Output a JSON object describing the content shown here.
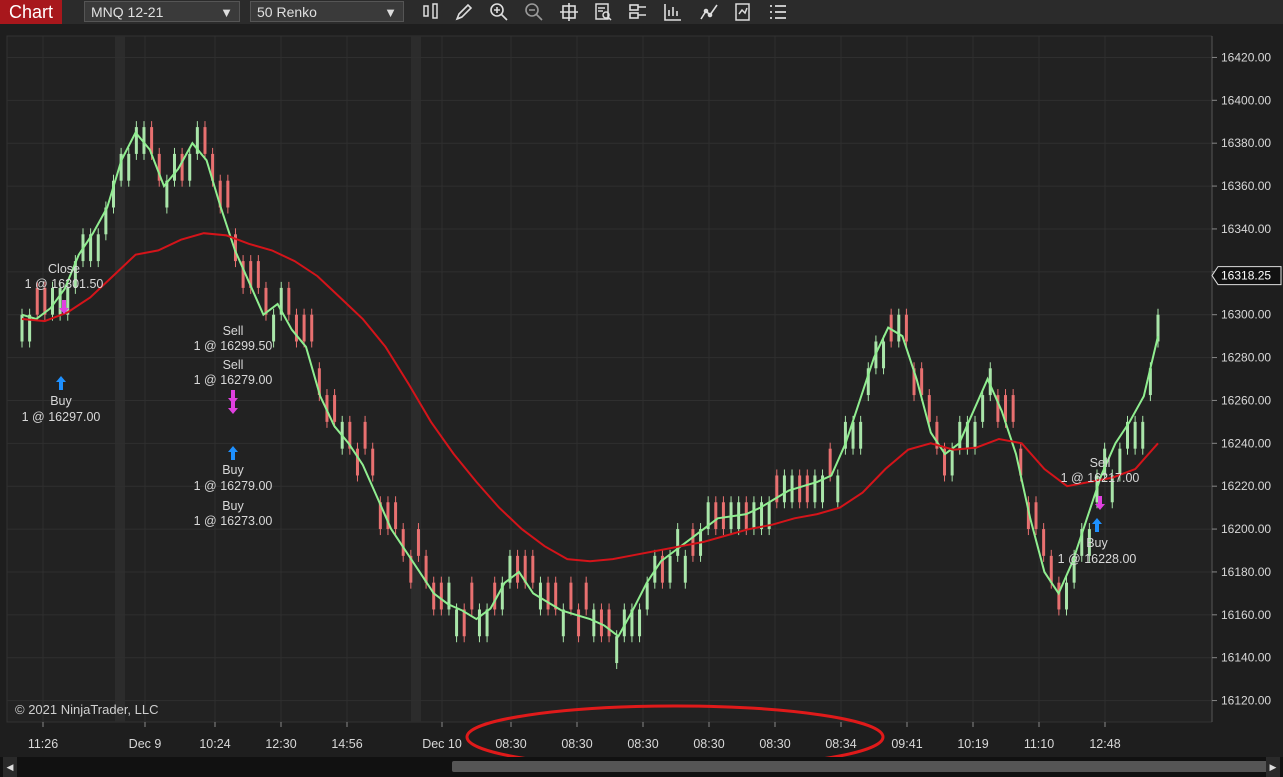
{
  "toolbar": {
    "chart_tab": "Chart",
    "instrument": "MNQ 12-21",
    "bar_type": "50 Renko",
    "icons": [
      "bar-style-icon",
      "pencil-icon",
      "zoom-in-icon",
      "zoom-out-icon",
      "crosshair-icon",
      "data-box-icon",
      "properties-icon",
      "chart-trader-icon",
      "strategy-icon",
      "indicators-icon",
      "more-icon"
    ]
  },
  "copyright": "© 2021 NinjaTrader, LLC",
  "price_axis": {
    "ticks": [
      "16420.00",
      "16400.00",
      "16380.00",
      "16360.00",
      "16340.00",
      "16320.00",
      "16300.00",
      "16280.00",
      "16260.00",
      "16240.00",
      "16220.00",
      "16200.00",
      "16180.00",
      "16160.00",
      "16140.00",
      "16120.00"
    ],
    "last_price": "16318.25"
  },
  "time_axis": [
    "11:26",
    "Dec 9",
    "10:24",
    "12:30",
    "14:56",
    "Dec 10",
    "08:30",
    "08:30",
    "08:30",
    "08:30",
    "08:30",
    "08:34",
    "09:41",
    "10:19",
    "11:10",
    "12:48"
  ],
  "executions": [
    {
      "action": "Close",
      "qty_price": "1 @ 16301.50"
    },
    {
      "action": "Buy",
      "qty_price": "1 @ 16297.00"
    },
    {
      "action": "Sell",
      "qty_price": "1 @ 16299.50"
    },
    {
      "action": "Sell",
      "qty_price": "1 @ 16279.00"
    },
    {
      "action": "Buy",
      "qty_price": "1 @ 16279.00"
    },
    {
      "action": "Buy",
      "qty_price": "1 @ 16273.00"
    },
    {
      "action": "Sell",
      "qty_price": "1 @ 16217.00"
    },
    {
      "action": "Buy",
      "qty_price": "1 @ 16228.00"
    }
  ],
  "colors": {
    "background": "#1e1e1e",
    "up_bar": "#a9e5a9",
    "down_bar": "#e87070",
    "fast_ma": "#90ee90",
    "slow_ma": "#d4141a",
    "annotation_circle": "#e01a1a",
    "buy_arrow": "#1e90ff",
    "sell_arrow": "#e040e0",
    "chart_tab": "#a8171c"
  },
  "chart_data": {
    "type": "line",
    "title": "",
    "ylim": [
      16110,
      16430
    ],
    "ylabel": "",
    "series": [
      {
        "values": [
          16300,
          16298,
          16303,
          16312,
          16328,
          16338,
          16350,
          16372,
          16385,
          16377,
          16360,
          16368,
          16380,
          16372,
          16350,
          16330,
          16315,
          16300,
          16305,
          16293,
          16285,
          16262,
          16248,
          16240,
          16230,
          16215,
          16200,
          16190,
          16180,
          16170,
          16165,
          16162,
          16158,
          16163,
          16175,
          16180,
          16170,
          16166,
          16162,
          16160,
          16158,
          16155,
          16150,
          16162,
          16175,
          16185,
          16190,
          16195,
          16200,
          16205,
          16206,
          16207,
          16210,
          16214,
          16218,
          16220,
          16222,
          16225,
          16240,
          16260,
          16280,
          16294,
          16290,
          16270,
          16245,
          16235,
          16240,
          16255,
          16270,
          16255,
          16235,
          16205,
          16180,
          16170,
          16185,
          16205,
          16225,
          16240,
          16250,
          16262,
          16290
        ]
      },
      {
        "values": [
          16298,
          16297,
          16301,
          16308,
          16318,
          16328,
          16330,
          16335,
          16338,
          16337,
          16333,
          16330,
          16325,
          16318,
          16308,
          16298,
          16285,
          16268,
          16250,
          16235,
          16222,
          16210,
          16200,
          16192,
          16186,
          16185,
          16186,
          16188,
          16190,
          16192,
          16194,
          16197,
          16200,
          16202,
          16205,
          16207,
          16210,
          16217,
          16228,
          16237,
          16240,
          16237,
          16238,
          16242,
          16240,
          16228,
          16220,
          16222,
          16224,
          16228,
          16240
        ]
      }
    ]
  }
}
